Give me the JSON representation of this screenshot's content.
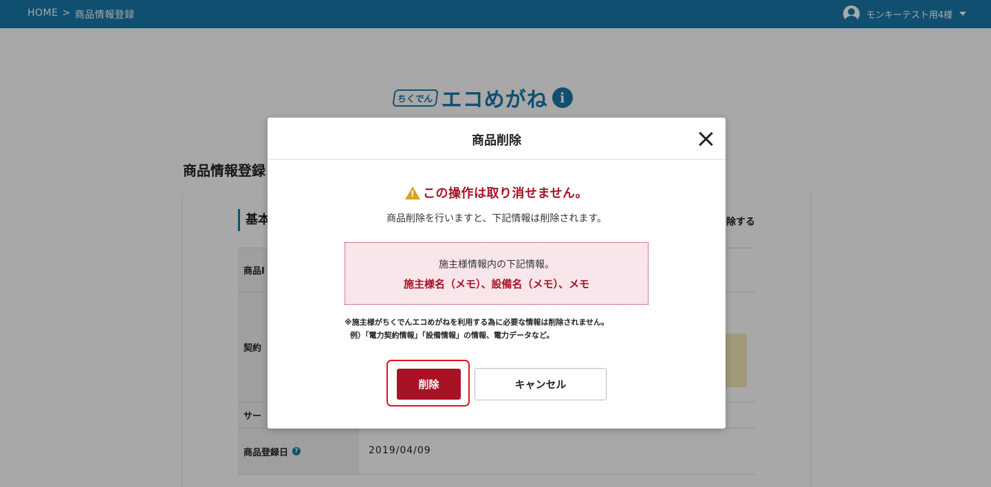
{
  "header": {
    "breadcrumb": [
      "HOME",
      ">",
      "商品情報登録"
    ],
    "user_name": "モンキーテスト用4様"
  },
  "logo": {
    "small_text": "ちくでん",
    "main_text": "エコめがね",
    "info_mark": "i"
  },
  "page": {
    "title": "商品情報登録",
    "section_title": "基本",
    "delete_link": "除する",
    "rows": [
      {
        "label": "商品I",
        "value": ""
      },
      {
        "label": "契約",
        "value": ""
      },
      {
        "label": "サー",
        "value": ""
      },
      {
        "label": "商品登録日",
        "value": "2019/04/09"
      }
    ]
  },
  "modal": {
    "title": "商品削除",
    "warning": "この操作は取り消せません。",
    "description": "商品削除を行いますと、下記情報は削除されます。",
    "info_line1": "施主様情報内の下記情報。",
    "info_line2": "施主様名（メモ）、設備名（メモ）、メモ",
    "note_line1": "※施主様がちくでんエコめがねを利用する為に必要な情報は削除されません。",
    "note_line2": "例）「電力契約情報」「設備情報」の情報、電力データなど。",
    "delete_label": "削除",
    "cancel_label": "キャンセル"
  },
  "colors": {
    "brand": "#1978aa",
    "danger": "#a81225",
    "warning": "#d9a51b",
    "focus": "#e0101e"
  }
}
